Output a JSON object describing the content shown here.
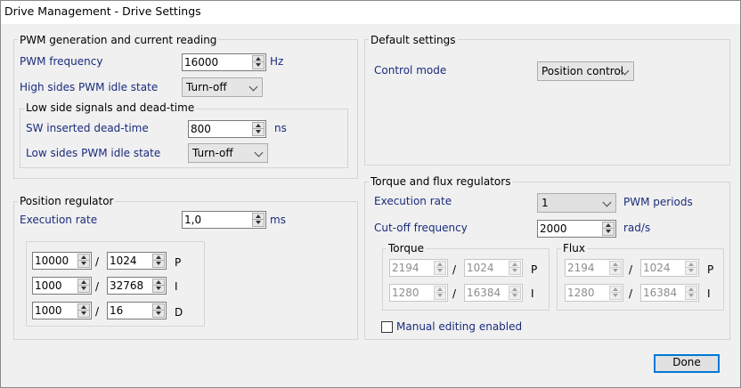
{
  "window": {
    "title": "Drive Management - Drive Settings"
  },
  "pwm": {
    "group_title": "PWM generation and current reading",
    "frequency_label": "PWM frequency",
    "frequency_value": "16000",
    "frequency_unit": "Hz",
    "high_idle_label": "High sides PWM idle state",
    "high_idle_value": "Turn-off",
    "low_side": {
      "group_title": "Low side signals and dead-time",
      "deadtime_label": "SW inserted dead-time",
      "deadtime_value": "800",
      "deadtime_unit": "ns",
      "low_idle_label": "Low sides PWM idle state",
      "low_idle_value": "Turn-off"
    }
  },
  "position": {
    "group_title": "Position regulator",
    "exec_label": "Execution rate",
    "exec_value": "1,0",
    "exec_unit": "ms",
    "gains": [
      {
        "num": "10000",
        "den": "1024",
        "label": "P"
      },
      {
        "num": "1000",
        "den": "32768",
        "label": "I"
      },
      {
        "num": "1000",
        "den": "16",
        "label": "D"
      }
    ],
    "slash": "/"
  },
  "defaults": {
    "group_title": "Default settings",
    "control_mode_label": "Control mode",
    "control_mode_value": "Position control"
  },
  "torque_flux": {
    "group_title": "Torque and flux regulators",
    "exec_label": "Execution rate",
    "exec_value": "1",
    "exec_unit": "PWM periods",
    "cutoff_label": "Cut-off frequency",
    "cutoff_value": "2000",
    "cutoff_unit": "rad/s",
    "torque": {
      "title": "Torque",
      "p_num": "2194",
      "p_den": "1024",
      "p_label": "P",
      "i_num": "1280",
      "i_den": "16384",
      "i_label": "I"
    },
    "flux": {
      "title": "Flux",
      "p_num": "2194",
      "p_den": "1024",
      "p_label": "P",
      "i_num": "1280",
      "i_den": "16384",
      "i_label": "I"
    },
    "manual_label": "Manual editing enabled"
  },
  "footer": {
    "done_label": "Done"
  }
}
